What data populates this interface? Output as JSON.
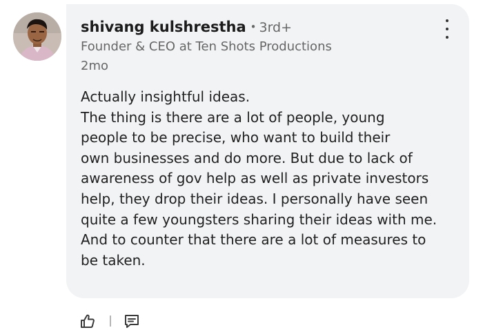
{
  "comment": {
    "author_name": "shivang kulshrestha",
    "separator": "•",
    "connection_degree": "3rd+",
    "headline": "Founder & CEO at Ten Shots Productions",
    "time_ago": "2mo",
    "body_lines": [
      "Actually insightful ideas.",
      "The thing is there are a lot of people, young",
      "people to be precise, who want to build their",
      "own businesses and do more. But due to lack of",
      "awareness of gov help as well as private investors",
      "help, they drop their ideas. I personally have seen",
      "quite a few youngsters sharing their ideas with me.",
      "And to counter that there are a lot of measures to",
      "be taken."
    ]
  },
  "icons": {
    "more": "more-vertical-icon",
    "like": "thumbs-up-icon",
    "reply": "comment-icon"
  },
  "colors": {
    "bubble": "#f2f3f5",
    "primary_text": "#1b1b1b",
    "secondary_text": "#666666",
    "icon": "#3a3a3a"
  }
}
